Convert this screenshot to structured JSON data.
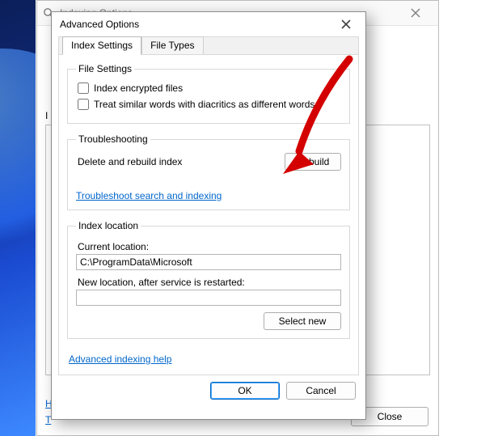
{
  "backDialog": {
    "title": "Indexing Options",
    "listLabelFirstChar": "I",
    "linkLeft1FirstChar": "H",
    "linkLeft2FirstChar": "T",
    "closeButton": "Close"
  },
  "dialog": {
    "title": "Advanced Options",
    "tabs": {
      "indexSettings": "Index Settings",
      "fileTypes": "File Types"
    },
    "fileSettings": {
      "legend": "File Settings",
      "indexEncrypted": "Index encrypted files",
      "treatDiacritics": "Treat similar words with diacritics as different words"
    },
    "troubleshooting": {
      "legend": "Troubleshooting",
      "deleteRebuildLabel": "Delete and rebuild index",
      "rebuildButton": "Rebuild",
      "tsLink": "Troubleshoot search and indexing"
    },
    "indexLocation": {
      "legend": "Index location",
      "currentLabel": "Current location:",
      "currentValue": "C:\\ProgramData\\Microsoft",
      "newLabel": "New location, after service is restarted:",
      "newValue": "",
      "selectNewButton": "Select new"
    },
    "helpLink": "Advanced indexing help",
    "okButton": "OK",
    "cancelButton": "Cancel"
  }
}
